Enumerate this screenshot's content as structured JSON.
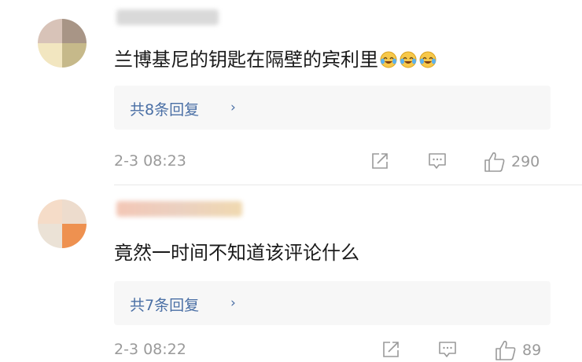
{
  "comments": [
    {
      "text": "兰博基尼的钥匙在隔壁的宾利里",
      "emojis": [
        "laugh-cry-icon",
        "laugh-cry-icon",
        "laugh-cry-icon"
      ],
      "replies_label": "共8条回复",
      "replies_chevron": "›",
      "time": "2-3 08:23",
      "likes": "290"
    },
    {
      "text": "竟然一时间不知道该评论什么",
      "replies_label": "共7条回复",
      "replies_chevron": "›",
      "time": "2-3 08:22",
      "likes": "89"
    }
  ],
  "colors": {
    "link": "#4a6fa5",
    "meta": "#9a9a9a",
    "reply_bg": "#f7f7f7"
  }
}
